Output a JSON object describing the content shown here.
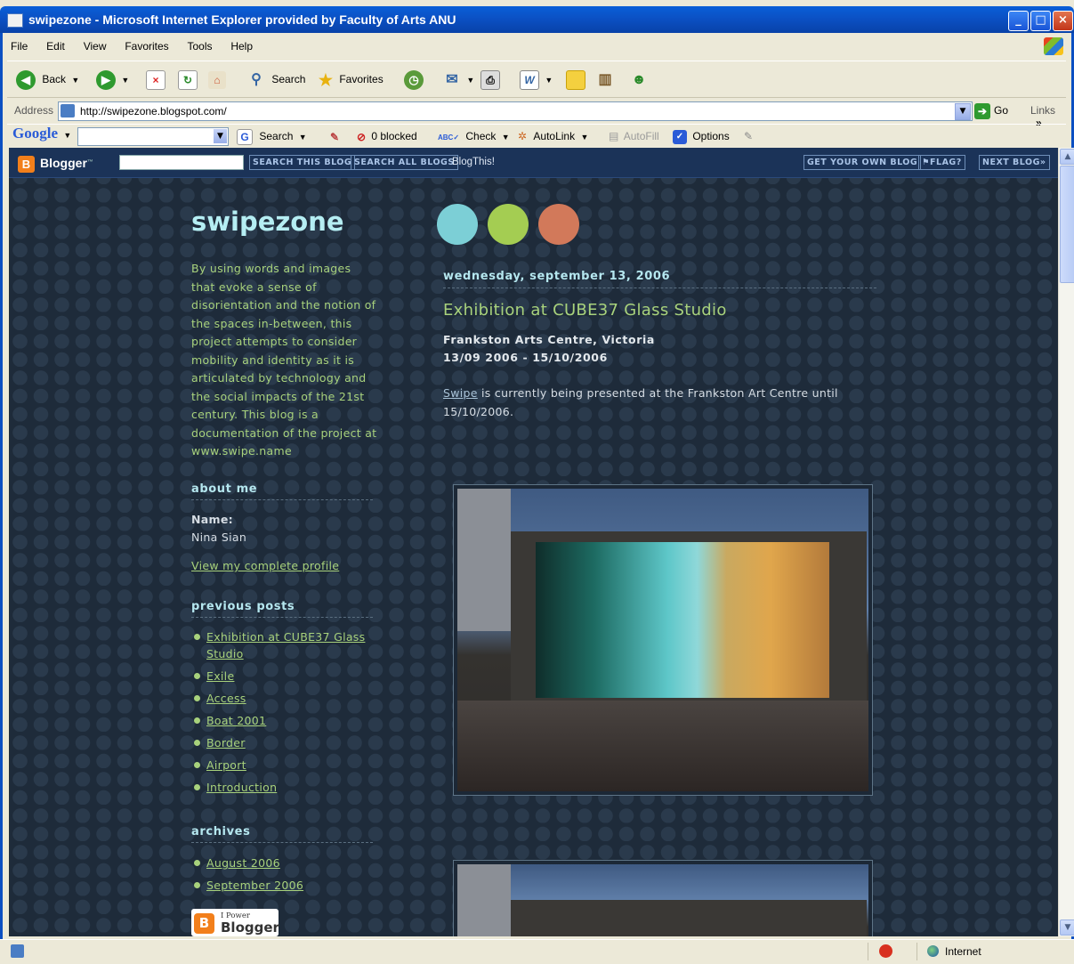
{
  "window": {
    "title": "swipezone - Microsoft Internet Explorer provided by Faculty of Arts ANU",
    "controls": {
      "minimize": "_",
      "maximize": "□",
      "close": "×"
    }
  },
  "menu": [
    "File",
    "Edit",
    "View",
    "Favorites",
    "Tools",
    "Help"
  ],
  "toolbar": {
    "back": "Back",
    "search": "Search",
    "favorites": "Favorites"
  },
  "address": {
    "label": "Address",
    "url": "http://swipezone.blogspot.com/",
    "go": "Go",
    "links": "Links",
    "more": "»"
  },
  "google_toolbar": {
    "logo": "Google",
    "search": "Search",
    "blocked": "0 blocked",
    "check": "Check",
    "autolink": "AutoLink",
    "autofill": "AutoFill",
    "options": "Options"
  },
  "blogger_bar": {
    "logo": "Blogger",
    "tm": "™",
    "search_this": "SEARCH THIS BLOG",
    "search_all": "SEARCH ALL BLOGS",
    "blogthis": "BlogThis!",
    "get_own": "GET YOUR OWN BLOG",
    "flag": "FLAG?",
    "next": "NEXT BLOG»"
  },
  "blog": {
    "title": "swipezone",
    "description": "By using words and images that evoke a sense of disorientation and the notion of the spaces in-between, this project attempts to consider mobility and identity as it is articulated by technology and the social impacts of the 21st century. This blog is a documentation of the project at www.swipe.name",
    "dot_colors": [
      "#7ccfd6",
      "#a4cd52",
      "#d2795a"
    ]
  },
  "sidebar": {
    "about_heading": "about me",
    "name_label": "Name:",
    "name_value": "Nina Sian",
    "profile_link": "View my complete profile",
    "previous_heading": "previous posts",
    "previous_posts": [
      "Exhibition at CUBE37 Glass Studio",
      "Exile",
      "Access",
      "Boat 2001",
      "Border",
      "Airport",
      "Introduction"
    ],
    "archives_heading": "archives",
    "archives": [
      "August 2006",
      "September 2006"
    ],
    "powered_line1": "I Power",
    "powered_line2": "Blogger"
  },
  "post": {
    "date": "wednesday, september 13, 2006",
    "title": "Exhibition at CUBE37 Glass Studio",
    "venue": "Frankston Arts Centre, Victoria",
    "dates": "13/09 2006 - 15/10/2006",
    "link_text": "Swipe",
    "body": " is currently being presented at the Frankston Art Centre until 15/10/2006."
  },
  "status": {
    "zone": "Internet"
  }
}
